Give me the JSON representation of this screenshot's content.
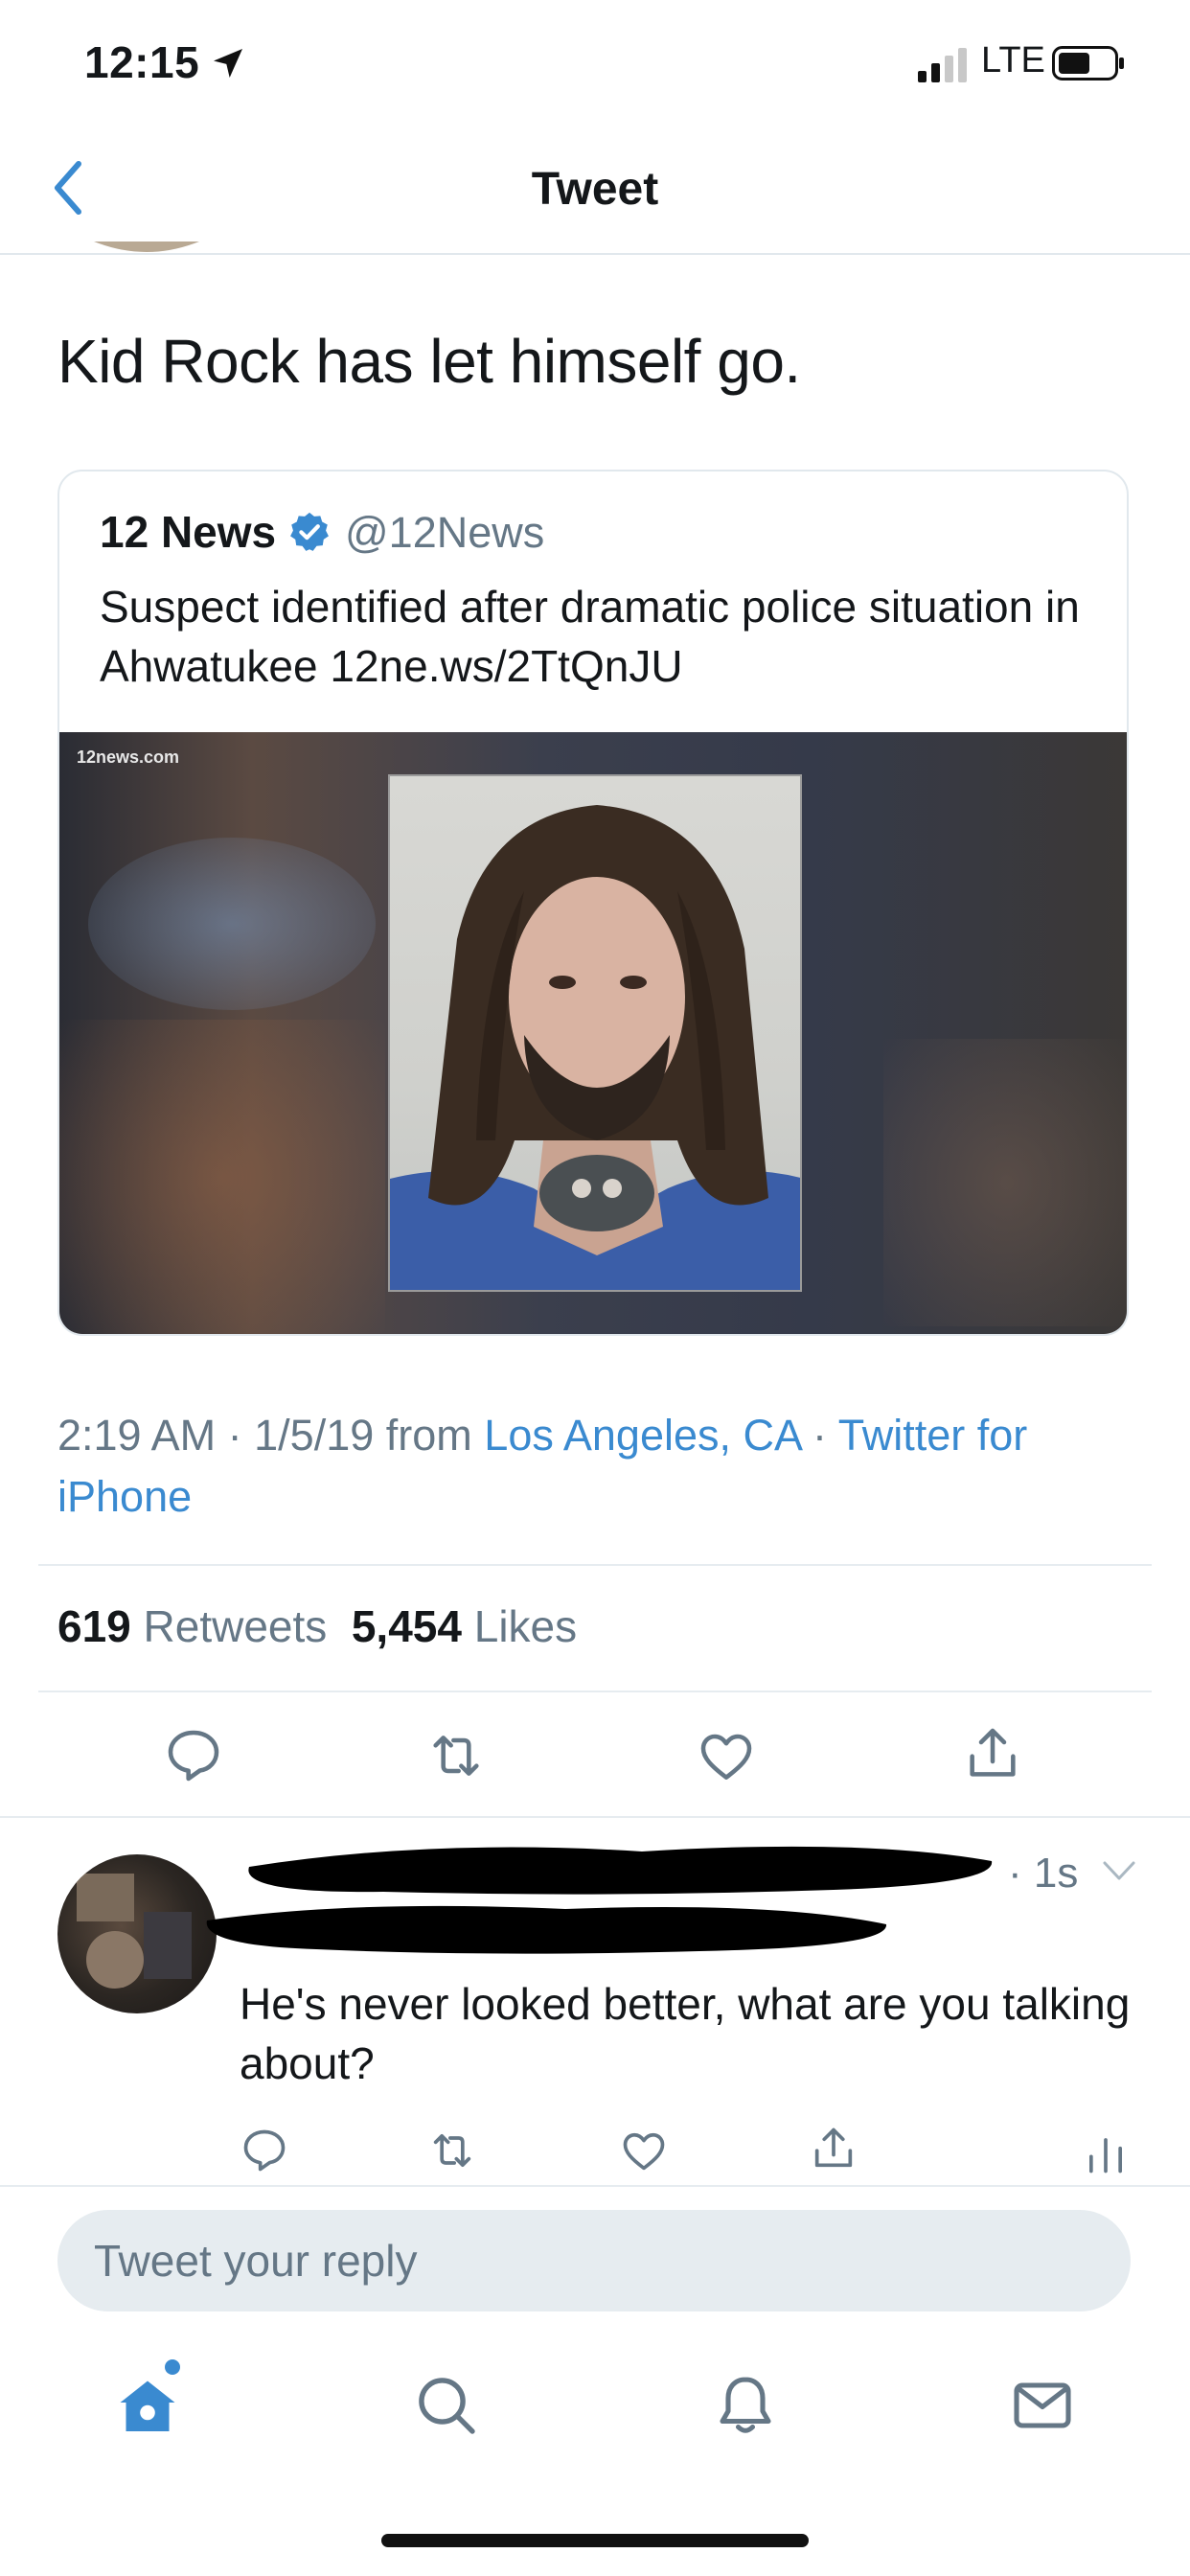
{
  "status_bar": {
    "time": "12:15",
    "network": "LTE"
  },
  "nav": {
    "title": "Tweet"
  },
  "tweet": {
    "text": "Kid Rock has let himself go."
  },
  "quoted": {
    "name": "12 News",
    "handle": "@12News",
    "text": "Suspect identified after dramatic police situation in Ahwatukee 12ne.ws/2TtQnJU",
    "watermark": "12news.com"
  },
  "meta": {
    "time": "2:19 AM",
    "date": "1/5/19",
    "from": "from",
    "location": "Los Angeles, CA",
    "client": "Twitter for iPhone",
    "separator": "·"
  },
  "stats": {
    "retweets_count": "619",
    "retweets_label": "Retweets",
    "likes_count": "5,454",
    "likes_label": "Likes"
  },
  "reply": {
    "time": "· 1s",
    "text": "He's never looked better, what are you talking about?"
  },
  "composer": {
    "placeholder": "Tweet your reply"
  },
  "colors": {
    "accent": "#3a8ad0",
    "secondary_text": "#657786",
    "divider": "#e6ecf0"
  },
  "icons": [
    "location-arrow-icon",
    "signal-icon",
    "battery-icon",
    "back-chevron-icon",
    "verified-badge-icon",
    "reply-icon",
    "retweet-icon",
    "like-icon",
    "share-icon",
    "analytics-icon",
    "home-icon",
    "search-icon",
    "notifications-icon",
    "messages-icon"
  ]
}
